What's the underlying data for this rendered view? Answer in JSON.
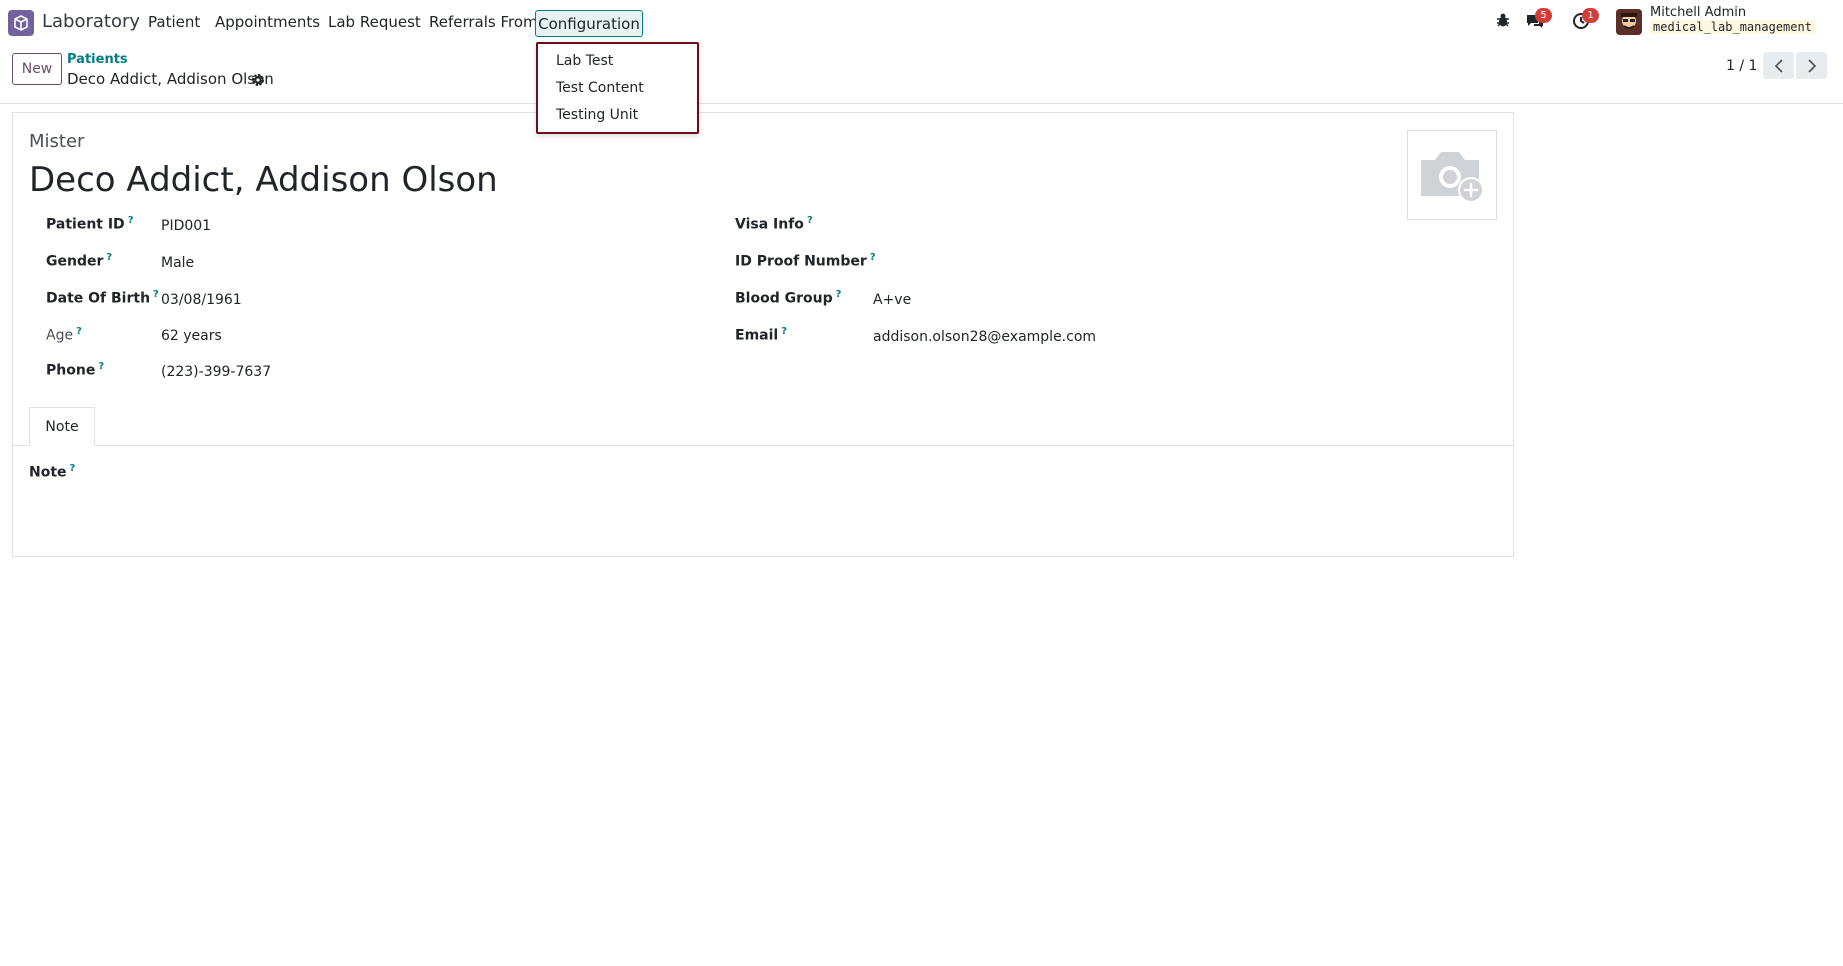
{
  "app": {
    "name": "Laboratory",
    "brand_color": "#71639e",
    "accent_color": "#017e84"
  },
  "nav": {
    "items": [
      "Patient",
      "Appointments",
      "Lab Request",
      "Referrals From"
    ],
    "active": "Configuration"
  },
  "dropdown": {
    "items": [
      "Lab Test",
      "Test Content",
      "Testing Unit"
    ]
  },
  "systray": {
    "debug_icon": "bug-icon",
    "messages_icon": "chat-icon",
    "messages_count": "5",
    "activity_icon": "clock-icon",
    "activity_count": "1",
    "user_name": "Mitchell Admin",
    "database": "medical_lab_management"
  },
  "control_panel": {
    "new_label": "New",
    "breadcrumb_parent": "Patients",
    "breadcrumb_current": "Deco Addict, Addison Olson",
    "pager": "1 / 1"
  },
  "form": {
    "title_prefix": "Mister",
    "patient_name": "Deco Addict, Addison Olson",
    "left_fields": [
      {
        "label": "Patient ID",
        "value": "PID001"
      },
      {
        "label": "Gender",
        "value": "Male"
      },
      {
        "label": "Date Of Birth",
        "value": "03/08/1961"
      },
      {
        "label": "Age",
        "value": "62 years"
      },
      {
        "label": "Phone",
        "value": "(223)-399-7637"
      }
    ],
    "right_fields": [
      {
        "label": "Visa Info",
        "value": ""
      },
      {
        "label": "ID Proof Number",
        "value": ""
      },
      {
        "label": "Blood Group",
        "value": "A+ve"
      },
      {
        "label": "Email",
        "value": "addison.olson28@example.com"
      }
    ],
    "tabs": [
      "Note"
    ],
    "note_label": "Note",
    "help_mark": "?"
  }
}
